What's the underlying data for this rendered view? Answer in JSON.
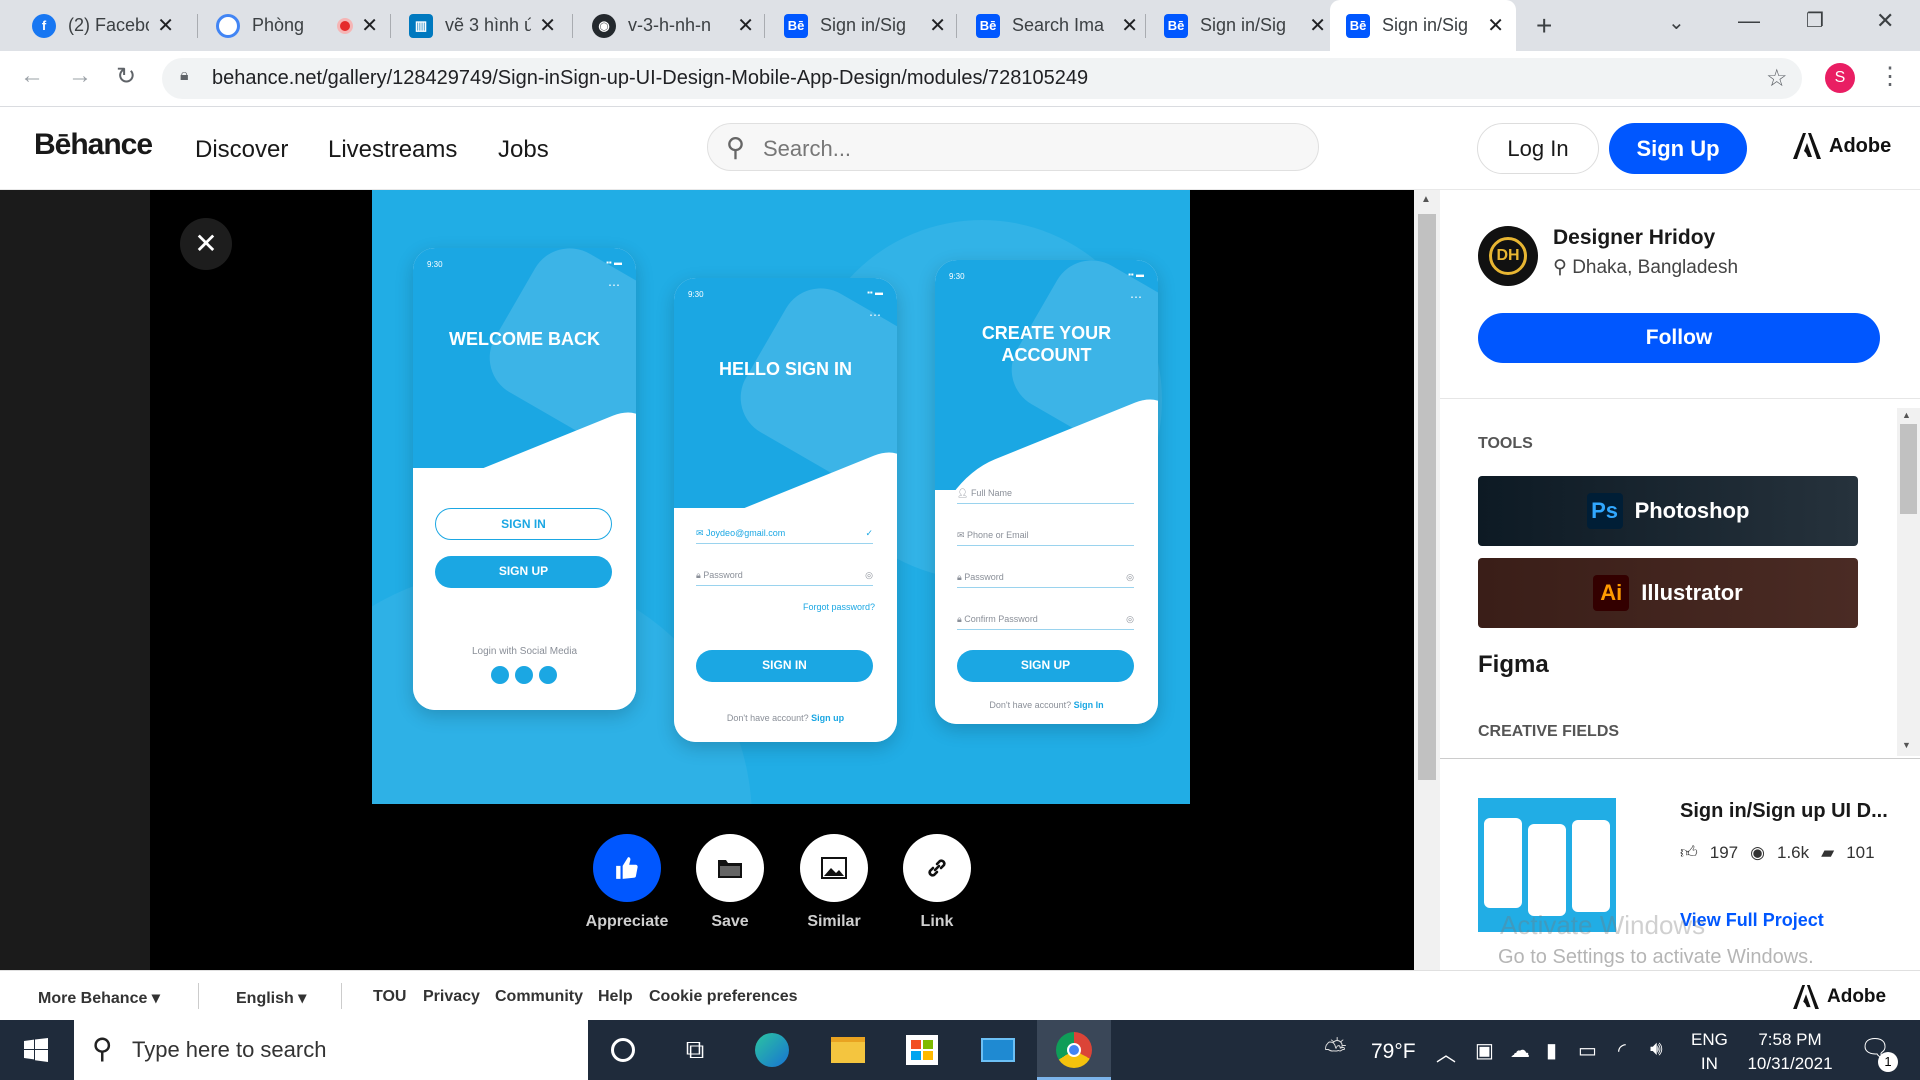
{
  "tabs": [
    {
      "title": "(2) Faceboo",
      "favicon": "facebook-icon",
      "color": "#1877f2",
      "glyph": "f"
    },
    {
      "title": "Phòng",
      "favicon": "meet-icon",
      "color": "#e94235",
      "glyph": "●"
    },
    {
      "title": "vẽ 3 hình ú",
      "favicon": "trello-icon",
      "color": "#0079bf",
      "glyph": "▥"
    },
    {
      "title": "v-3-h-nh-n",
      "favicon": "github-icon",
      "color": "#24292e",
      "glyph": "●"
    },
    {
      "title": "Sign in/Sig",
      "favicon": "behance-icon",
      "color": "#0057ff",
      "glyph": "Bē"
    },
    {
      "title": "Search Ima",
      "favicon": "behance-icon",
      "color": "#0057ff",
      "glyph": "Bē"
    },
    {
      "title": "Sign in/Sig",
      "favicon": "behance-icon",
      "color": "#0057ff",
      "glyph": "Bē"
    },
    {
      "title": "Sign in/Sig",
      "favicon": "behance-icon",
      "color": "#0057ff",
      "glyph": "Bē"
    }
  ],
  "address": {
    "url": "behance.net/gallery/128429749/Sign-inSign-up-UI-Design-Mobile-App-Design/modules/728105249",
    "profile_letter": "S"
  },
  "header": {
    "logo": "Bēhance",
    "nav": [
      "Discover",
      "Livestreams",
      "Jobs"
    ],
    "search_placeholder": "Search...",
    "login": "Log In",
    "signup": "Sign Up",
    "adobe": "Adobe"
  },
  "artwork": {
    "phone1": {
      "title": "WELCOME BACK",
      "signin": "SIGN IN",
      "signup": "SIGN UP",
      "social": "Login with Social Media",
      "time": "9:30"
    },
    "phone2": {
      "title": "HELLO SIGN IN",
      "email": "Joydeo@gmail.com",
      "password": "Password",
      "forgot": "Forgot password?",
      "button": "SIGN IN",
      "footer": "Don't have account?",
      "footer_link": "Sign up",
      "time": "9:30"
    },
    "phone3": {
      "title": "CREATE YOUR ACCOUNT",
      "f1": "Full Name",
      "f2": "Phone or Email",
      "f3": "Password",
      "f4": "Confirm Password",
      "button": "SIGN UP",
      "footer": "Don't have account?",
      "footer_link": "Sign In",
      "time": "9:30"
    }
  },
  "actions": {
    "appreciate": "Appreciate",
    "save": "Save",
    "similar": "Similar",
    "link": "Link"
  },
  "designer": {
    "name": "Designer Hridoy",
    "location": "Dhaka, Bangladesh",
    "follow": "Follow"
  },
  "tools": {
    "heading": "TOOLS",
    "items": [
      "Photoshop",
      "Illustrator",
      "Figma"
    ],
    "ps": "Ps",
    "ai": "Ai"
  },
  "creative_fields": "CREATIVE FIELDS",
  "project": {
    "title": "Sign in/Sign up UI D...",
    "likes": "197",
    "views": "1.6k",
    "comments": "101",
    "view_full": "View Full Project"
  },
  "watermark": {
    "line1": "Activate Windows",
    "line2": "Go to Settings to activate Windows."
  },
  "footer": {
    "more": "More Behance",
    "language": "English",
    "links": [
      "TOU",
      "Privacy",
      "Community",
      "Help",
      "Cookie preferences"
    ],
    "adobe": "Adobe"
  },
  "taskbar": {
    "search": "Type here to search",
    "weather": "79°F",
    "lang1": "ENG",
    "lang2": "IN",
    "time": "7:58 PM",
    "date": "10/31/2021",
    "notifications": "1"
  },
  "colors": {
    "behance_blue": "#0057ff",
    "art_blue": "#21ade5"
  }
}
